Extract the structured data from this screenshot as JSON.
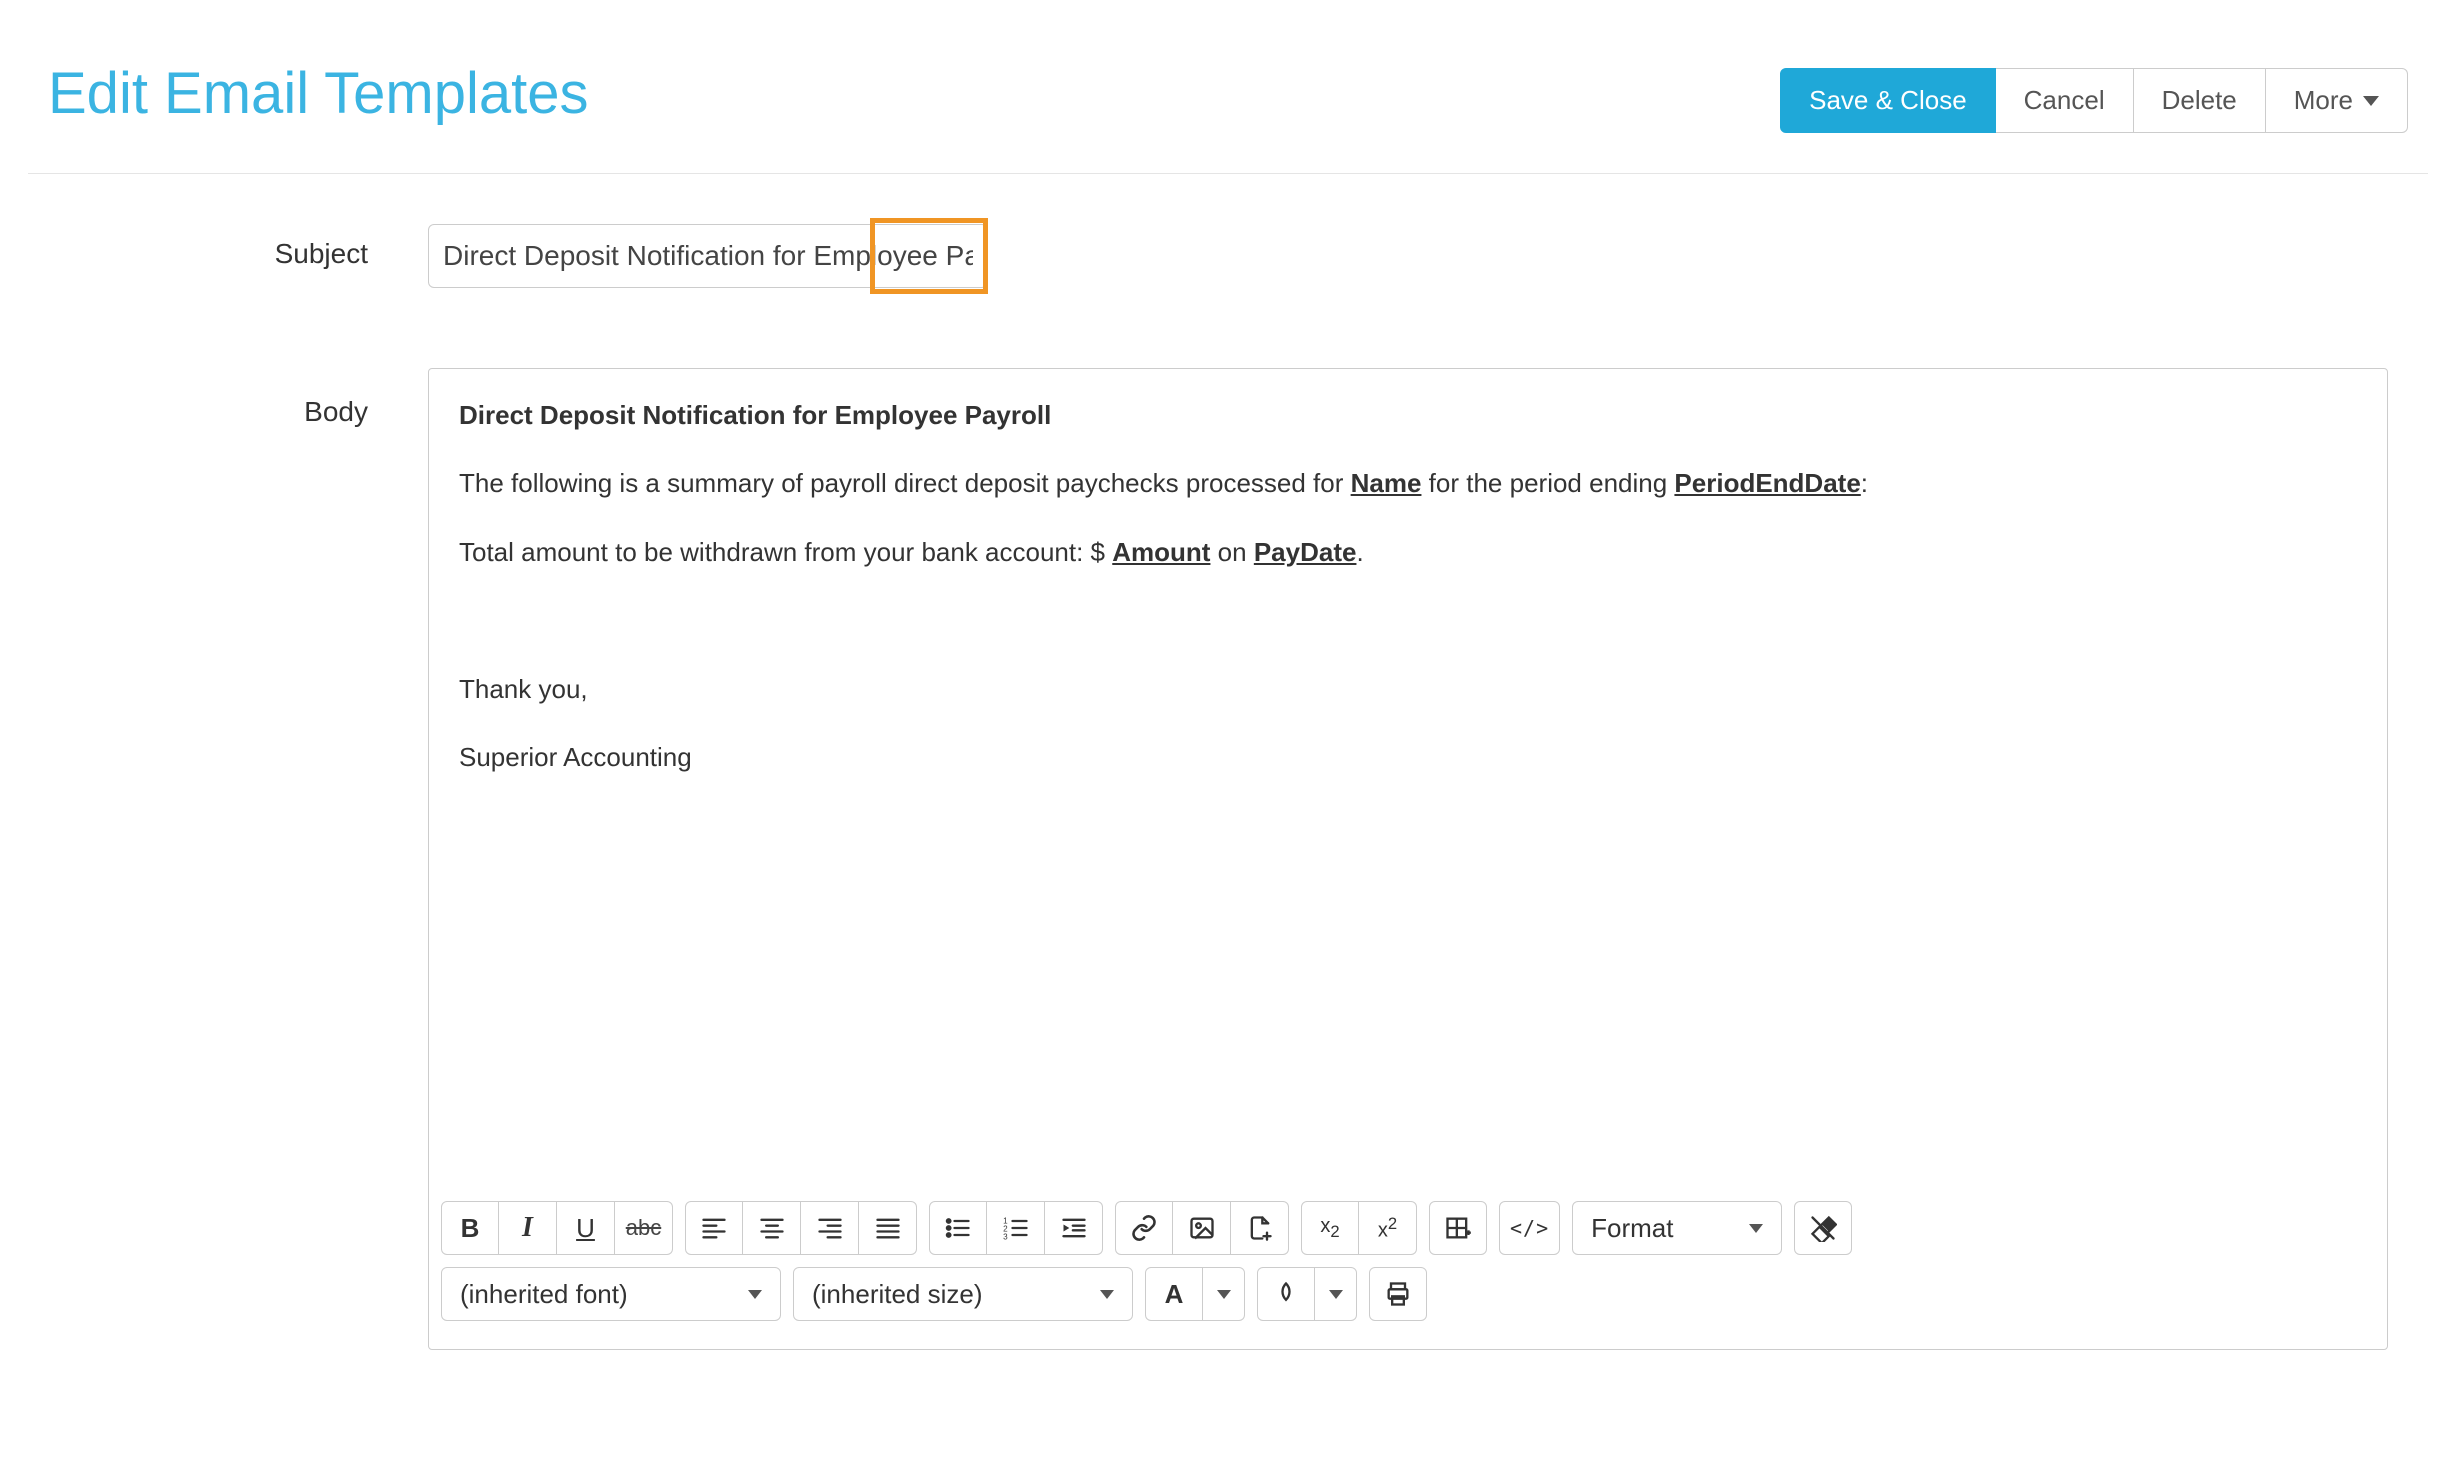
{
  "header": {
    "title": "Edit Email Templates",
    "buttons": {
      "save_close": "Save & Close",
      "cancel": "Cancel",
      "delete": "Delete",
      "more": "More"
    }
  },
  "form": {
    "subject_label": "Subject",
    "subject_value": "Direct Deposit Notification for Employee Payroll (Clone)",
    "body_label": "Body"
  },
  "body": {
    "title_line": "Direct Deposit Notification for Employee Payroll",
    "line2_pre": "The following is a summary of payroll direct deposit paychecks processed for ",
    "line2_field1": "Name",
    "line2_mid": " for the period ending ",
    "line2_field2": "PeriodEndDate",
    "line2_post": ":",
    "line3_pre": "Total amount to be withdrawn from your bank account:  $ ",
    "line3_field1": "Amount",
    "line3_mid": " on ",
    "line3_field2": "PayDate",
    "line3_post": ".",
    "thank_you": "Thank you,",
    "signature": "Superior Accounting"
  },
  "toolbar": {
    "font": "(inherited font)",
    "size": "(inherited size)",
    "format": "Format",
    "sub_label": "x",
    "sub_idx": "2",
    "sup_label": "x",
    "sup_idx": "2",
    "fontcolor_label": "A"
  }
}
